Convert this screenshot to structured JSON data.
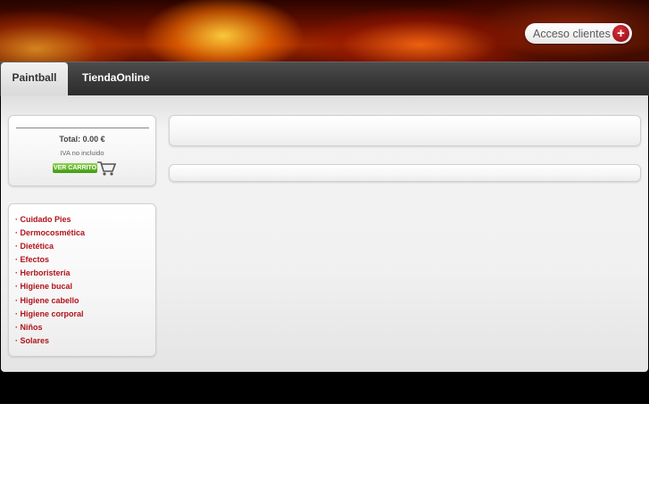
{
  "header": {
    "login_label": "Acceso clientes",
    "login_icon": "plus-circle-icon"
  },
  "nav": {
    "tabs": [
      {
        "label": "Paintball",
        "active": true
      },
      {
        "label": "TiendaOnline",
        "active": false
      }
    ]
  },
  "cart": {
    "total": "Total: 0.00 €",
    "tax_note": "IVA no incluido",
    "view_cart_label": "VER CARRITO",
    "icon": "shopping-cart-icon"
  },
  "categories": [
    "· Cuidado Pies",
    "· Dermocosmética",
    "· Dietética",
    "· Efectos",
    "· Herboristería",
    "· Higiene bucal",
    "· Higiene cabello",
    "· Higiene corporal",
    "· Niños",
    "· Solares"
  ],
  "colors": {
    "accent_red": "#b0121b",
    "nav_dark": "#3a3a3a",
    "cart_green": "#4caa1a"
  }
}
